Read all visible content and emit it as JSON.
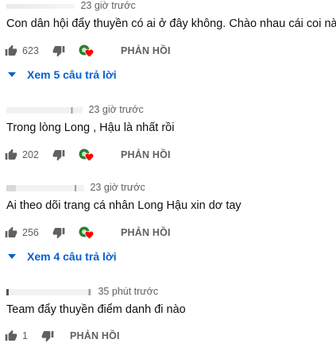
{
  "comments": [
    {
      "time": "23 giờ trước",
      "text": "Con dân hội đẩy thuyền có ai ở đây không. Chào nhau cái coi nào",
      "likes": "623",
      "reply_label": "PHẢN HỒI",
      "view_replies": "Xem 5 câu trả lời"
    },
    {
      "time": "23 giờ trước",
      "text": "Trong lòng Long , Hậu là nhất rồi",
      "likes": "202",
      "reply_label": "PHẢN HỒI"
    },
    {
      "time": "23 giờ trước",
      "text": "Ai theo dõi trang cá nhân Long Hậu xin dơ tay",
      "likes": "256",
      "reply_label": "PHẢN HỒI",
      "view_replies": "Xem 4 câu trả lời"
    },
    {
      "time": "35 phút trước",
      "text": "Team đẩy thuyền điểm danh đi nào",
      "likes": "1",
      "reply_label": "PHẢN HỒI"
    }
  ],
  "colors": {
    "link_blue": "#065fd4",
    "heart_red": "#ff0000",
    "avatar_green": "#2e7d32",
    "meta_gray": "#606060"
  },
  "icons": [
    "thumbs-up-icon",
    "thumbs-down-icon",
    "creator-heart-icon",
    "caret-down-icon"
  ]
}
